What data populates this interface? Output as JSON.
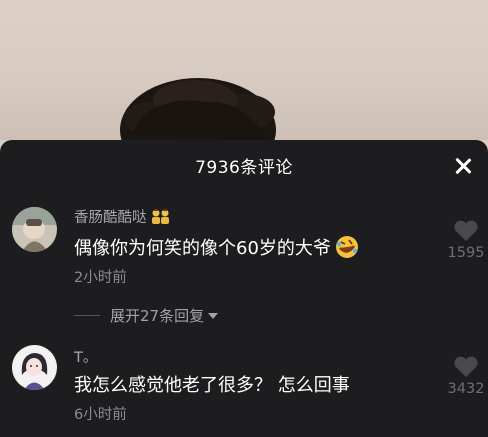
{
  "header": {
    "title": "7936条评论"
  },
  "comments": [
    {
      "username": "香肠酷酷哒",
      "text": "偶像你为何笑的像个60岁的大爷",
      "time": "2小时前",
      "likes": "1595",
      "badge_icon": "couple-emoji-icon",
      "content_emoji": "rofl-emoji-icon"
    },
    {
      "username": "T。",
      "text": "我怎么感觉他老了很多？ 怎么回事",
      "time": "6小时前",
      "likes": "3432"
    }
  ],
  "replies": {
    "expand_label": "展开27条回复"
  },
  "colors": {
    "sheet_bg": "#1d1d1f",
    "text_primary": "#ffffff",
    "text_secondary": "#a7a7a9",
    "text_muted": "#8c8c8e",
    "heart": "#4a4a4c"
  }
}
